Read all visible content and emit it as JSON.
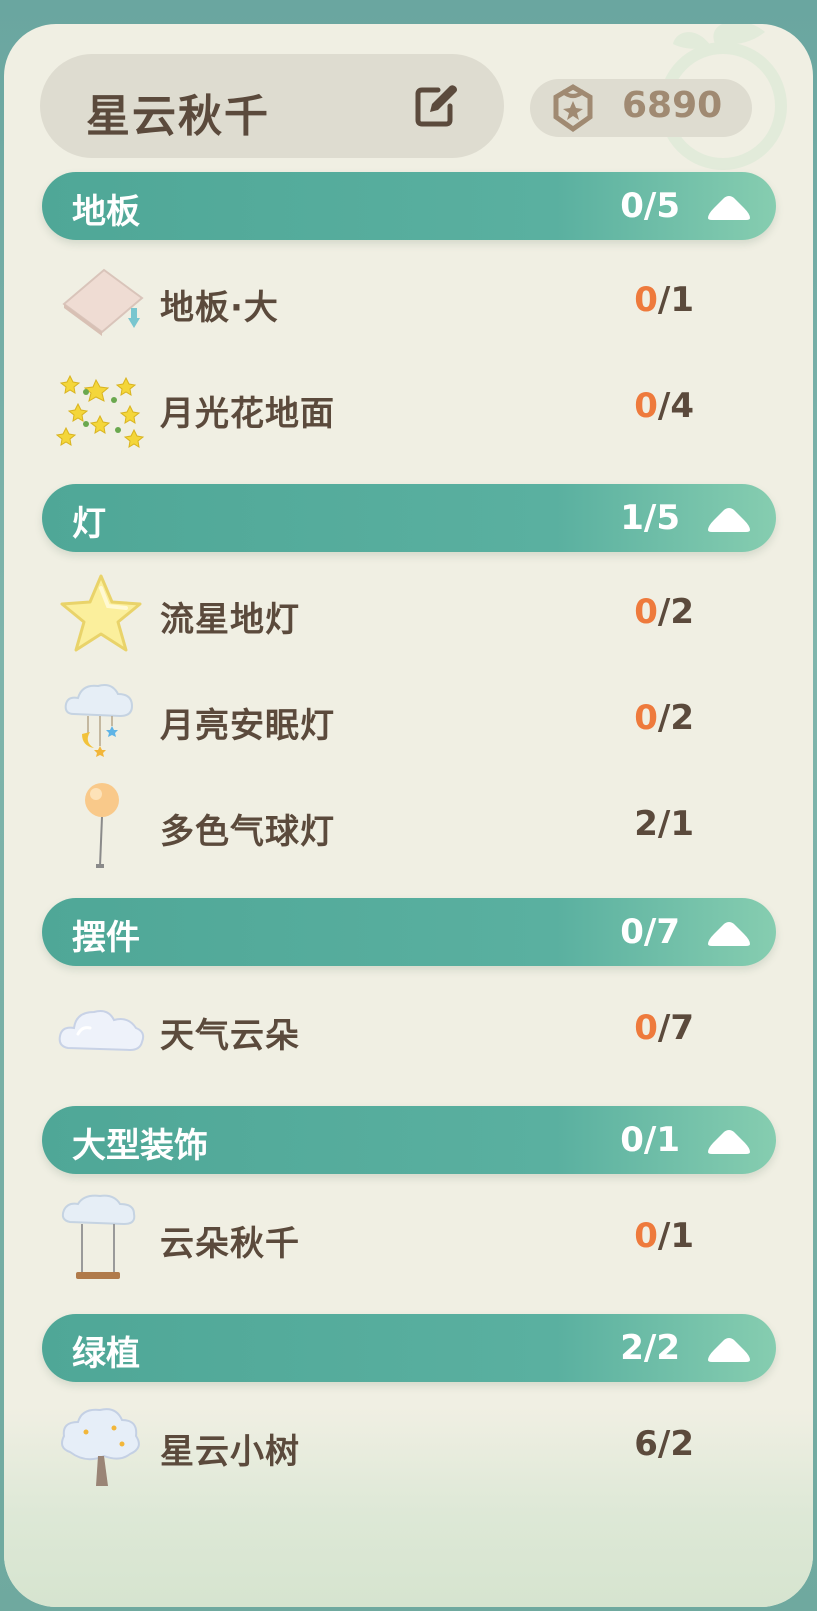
{
  "header": {
    "title": "星云秋千",
    "currency_value": "6890"
  },
  "colors": {
    "category_bar": "#55ab9b",
    "text_brown": "#5b4a3c",
    "highlight_orange": "#ee7a3c",
    "panel_bg": "#f0efe3"
  },
  "categories": [
    {
      "name": "地板",
      "count": "0/5",
      "items": [
        {
          "name": "地板·大",
          "owned": "0",
          "need": "/1",
          "icon": "floor-tile-icon"
        },
        {
          "name": "月光花地面",
          "owned": "0",
          "need": "/4",
          "icon": "moonflower-ground-icon"
        }
      ]
    },
    {
      "name": "灯",
      "count": "1/5",
      "items": [
        {
          "name": "流星地灯",
          "owned": "0",
          "need": "/2",
          "icon": "star-lamp-icon"
        },
        {
          "name": "月亮安眠灯",
          "owned": "0",
          "need": "/2",
          "icon": "moon-cloud-lamp-icon"
        },
        {
          "name": "多色气球灯",
          "owned": "2",
          "need": "/1",
          "icon": "balloon-lamp-icon"
        }
      ]
    },
    {
      "name": "摆件",
      "count": "0/7",
      "items": [
        {
          "name": "天气云朵",
          "owned": "0",
          "need": "/7",
          "icon": "cloud-icon"
        }
      ]
    },
    {
      "name": "大型装饰",
      "count": "0/1",
      "items": [
        {
          "name": "云朵秋千",
          "owned": "0",
          "need": "/1",
          "icon": "cloud-swing-icon"
        }
      ]
    },
    {
      "name": "绿植",
      "count": "2/2",
      "items": [
        {
          "name": "星云小树",
          "owned": "6",
          "need": "/2",
          "icon": "nebula-tree-icon"
        }
      ]
    }
  ]
}
